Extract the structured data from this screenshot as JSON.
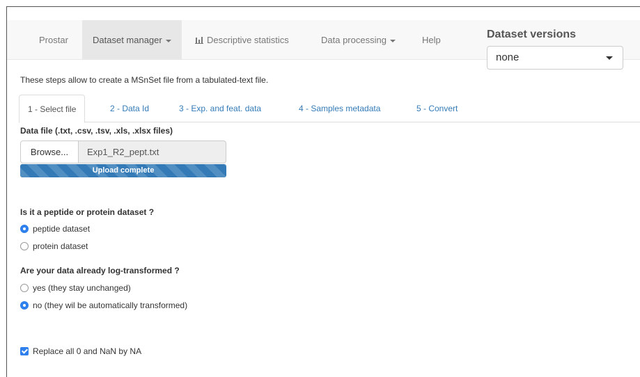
{
  "navbar": {
    "brand": "Prostar",
    "items": [
      {
        "label": "Dataset manager",
        "dropdown": true,
        "active": true
      },
      {
        "label": "Descriptive statistics",
        "icon": "bar-chart-icon"
      },
      {
        "label": "Data processing",
        "dropdown": true
      },
      {
        "label": "Help"
      }
    ]
  },
  "dataset_versions": {
    "label": "Dataset versions",
    "selected": "none"
  },
  "intro": "These steps allow to create a MSnSet file from a tabulated-text file.",
  "tabs": [
    {
      "label": "1 - Select file",
      "active": true
    },
    {
      "label": "2 - Data Id"
    },
    {
      "label": "3 - Exp. and feat. data"
    },
    {
      "label": "4 - Samples metadata"
    },
    {
      "label": "5 - Convert"
    }
  ],
  "file_input": {
    "label": "Data file (.txt, .csv, .tsv, .xls, .xlsx files)",
    "browse_label": "Browse...",
    "filename": "Exp1_R2_pept.txt",
    "progress_text": "Upload complete",
    "progress_percent": 100
  },
  "dataset_type": {
    "question": "Is it a peptide or protein dataset ?",
    "options": [
      {
        "label": "peptide dataset",
        "selected": true
      },
      {
        "label": "protein dataset",
        "selected": false
      }
    ]
  },
  "log_transform": {
    "question": "Are your data already log-transformed ?",
    "options": [
      {
        "label": "yes (they stay unchanged)",
        "selected": false
      },
      {
        "label": "no (they wil be automatically transformed)",
        "selected": true
      }
    ]
  },
  "replace_na": {
    "label": "Replace all 0 and NaN by NA",
    "checked": true
  },
  "colors": {
    "accent": "#337ab7",
    "radio_checked": "#2f80ed",
    "navbar_bg": "#f8f8f8"
  }
}
